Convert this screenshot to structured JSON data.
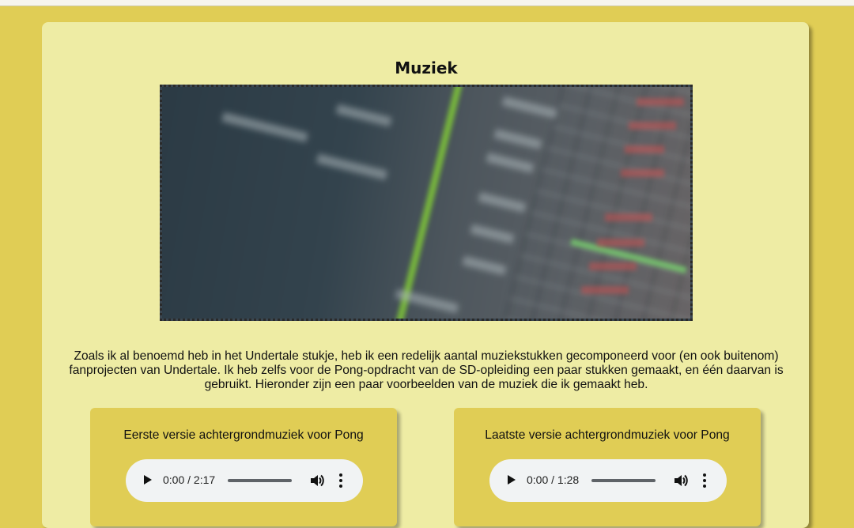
{
  "page": {
    "title": "Muziek",
    "intro": "Zoals ik al benoemd heb in het Undertale stukje, heb ik een redelijk aantal muziekstukken gecomponeerd voor (en ook buitenom) fanprojecten van Undertale. Ik heb zelfs voor de Pong-opdracht van de SD-opleiding een paar stukken gemaakt, en één daarvan is gebruikt. Hieronder zijn een paar voorbeelden van de muziek die ik gemaakt heb."
  },
  "tracks": [
    {
      "title": "Eerste versie achtergrondmuziek voor Pong",
      "time": "0:00 / 2:17"
    },
    {
      "title": "Laatste versie achtergrondmuziek voor Pong",
      "time": "0:00 / 1:28"
    }
  ],
  "colors": {
    "background": "#e0cd55",
    "card": "#eeeca4",
    "player": "#f1f3f4"
  },
  "icons": [
    "play-icon",
    "volume-icon",
    "more-options-icon"
  ]
}
